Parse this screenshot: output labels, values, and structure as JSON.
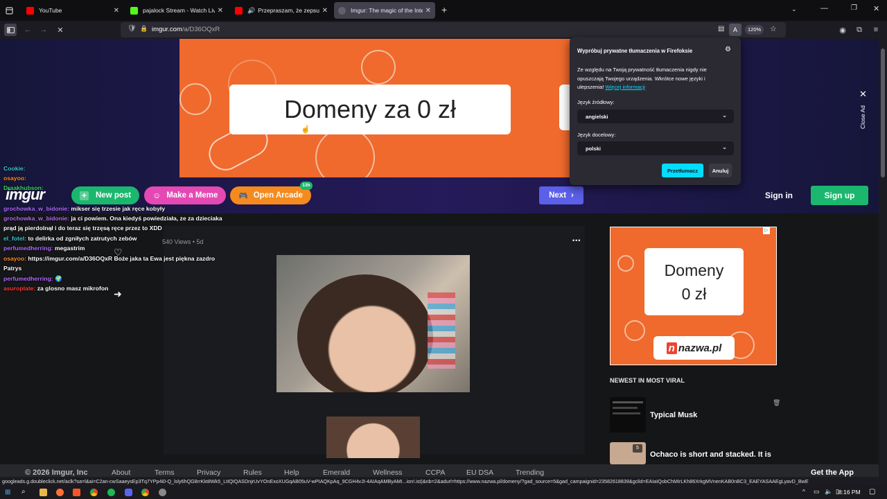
{
  "browser": {
    "tabs": [
      {
        "title": "YouTube",
        "close": "✕",
        "active": false,
        "favicon_color": "#ff0000"
      },
      {
        "title": "pajalock Stream - Watch Live on",
        "close": "✕",
        "active": false,
        "favicon_color": "#53fc18"
      },
      {
        "title": "Przepraszam, że zepsułam",
        "close": "✕",
        "active": false,
        "favicon_color": "#ff0000"
      },
      {
        "title": "Imgur: The magic of the Interne",
        "close": "✕",
        "active": true,
        "favicon_color": "#5f6368"
      }
    ],
    "new_tab": "+",
    "url_host": "imgur.com",
    "url_path": "/a/D36OQxR",
    "zoom": "120%",
    "status_url": "googleads.g.doubleclick.net/aclk?sa=l&ai=C2an-cwSaaeysEp3Tq7YPp4i0-Q_lsly6hQG8rrKkt8Wk5_LtIQIQASDnjrUvYOnExoXUGqAB05uV-wPIAQKpAq_9CGH4vJI-4AIAqAMByAMI...ion!.ist)&nb=2&adurl=https://www.nazwa.pl/domeny/?gad_source=5&gad_campaignid=23582618839&gclid=EAIaIQobChMIrLKh86XrkgMVnenKAB0nBC3_EAEYASAAEgLyavD_BwE"
  },
  "translation_popup": {
    "title": "Wypróbuj prywatne tłumaczenia w Firefoksie",
    "body": "Ze względu na Twoją prywatność tłumaczenia nigdy nie opuszczają Twojego urządzenia. Wkrótce nowe języki i ulepszenia!",
    "more_link": "Więcej informacji",
    "source_label": "Język źródłowy:",
    "source_value": "angielski",
    "target_label": "Język docelowy:",
    "target_value": "polski",
    "translate_button": "Przetłumacz",
    "cancel_button": "Anuluj"
  },
  "ads": {
    "big_banner_text": "Domeny za 0 zł",
    "close_ad": "Close Ad",
    "side_text_line1": "Domeny",
    "side_text_line2": "0 zł",
    "side_logo": "nazwa.pl",
    "side_logo_badge": "n"
  },
  "imgur": {
    "logo": "imgur",
    "new_post": "New post",
    "make_meme": "Make a Meme",
    "open_arcade": "Open Arcade",
    "arcade_badge": "13h",
    "next": "Next",
    "sign_in": "Sign in",
    "sign_up": "Sign up",
    "views": "540 Views",
    "age": "5d",
    "more": "•••",
    "newest_heading": "NEWEST IN MOST VIRAL",
    "viral_items": [
      {
        "title": "Typical Musk"
      },
      {
        "title": "Ochaco is short and stacked. It is",
        "badge": "5"
      }
    ]
  },
  "chat": [
    {
      "user": "Cookie:",
      "user_color": "#3ec9d6",
      "text": ""
    },
    {
      "user": "osayoo:",
      "user_color": "#ff8c2a",
      "text": ""
    },
    {
      "user": "Draakhubson:",
      "user_color": "#3bd46a",
      "text": ""
    },
    {
      "user": "grochowka_w_bidonie:",
      "user_color": "#b36cff",
      "text": "mikser się trzesie jak ręce kobyły"
    },
    {
      "user": "grochowka_w_bidonie:",
      "user_color": "#b36cff",
      "text": "ja ci powiem. Ona kiedyś powiedziała, ze za dzieciaka"
    },
    {
      "user": "",
      "user_color": "#ffffff",
      "text": "prąd ją pierdolnął i do teraz się trzęsą ręce przez to XDD"
    },
    {
      "user": "el_fotel:",
      "user_color": "#3ec9d6",
      "text": "to delirka od zgniłych zatrutych zebów"
    },
    {
      "user": "perfumedherring:",
      "user_color": "#b36cff",
      "text": "megastrim"
    },
    {
      "user": "osayoo:",
      "user_color": "#ff8c2a",
      "text": "https://imgur.com/a/D36OQxR Boże jaka ta Ewa jest piękna zazdro"
    },
    {
      "user": "",
      "user_color": "#ffffff",
      "text": "Patrys"
    },
    {
      "user": "perfumedherring:",
      "user_color": "#b36cff",
      "text": "🌍"
    },
    {
      "user": "asuroplate:",
      "user_color": "#ff3b3b",
      "text": "za glosno masz mikrofon"
    }
  ],
  "footer": {
    "copyright": "© 2026 Imgur, Inc",
    "links": [
      "About",
      "Terms",
      "Privacy",
      "Rules",
      "Help",
      "Emerald",
      "Wellness",
      "CCPA",
      "EU DSA",
      "Trending"
    ],
    "get_app": "Get the App"
  },
  "taskbar": {
    "time": "8:16 PM"
  }
}
